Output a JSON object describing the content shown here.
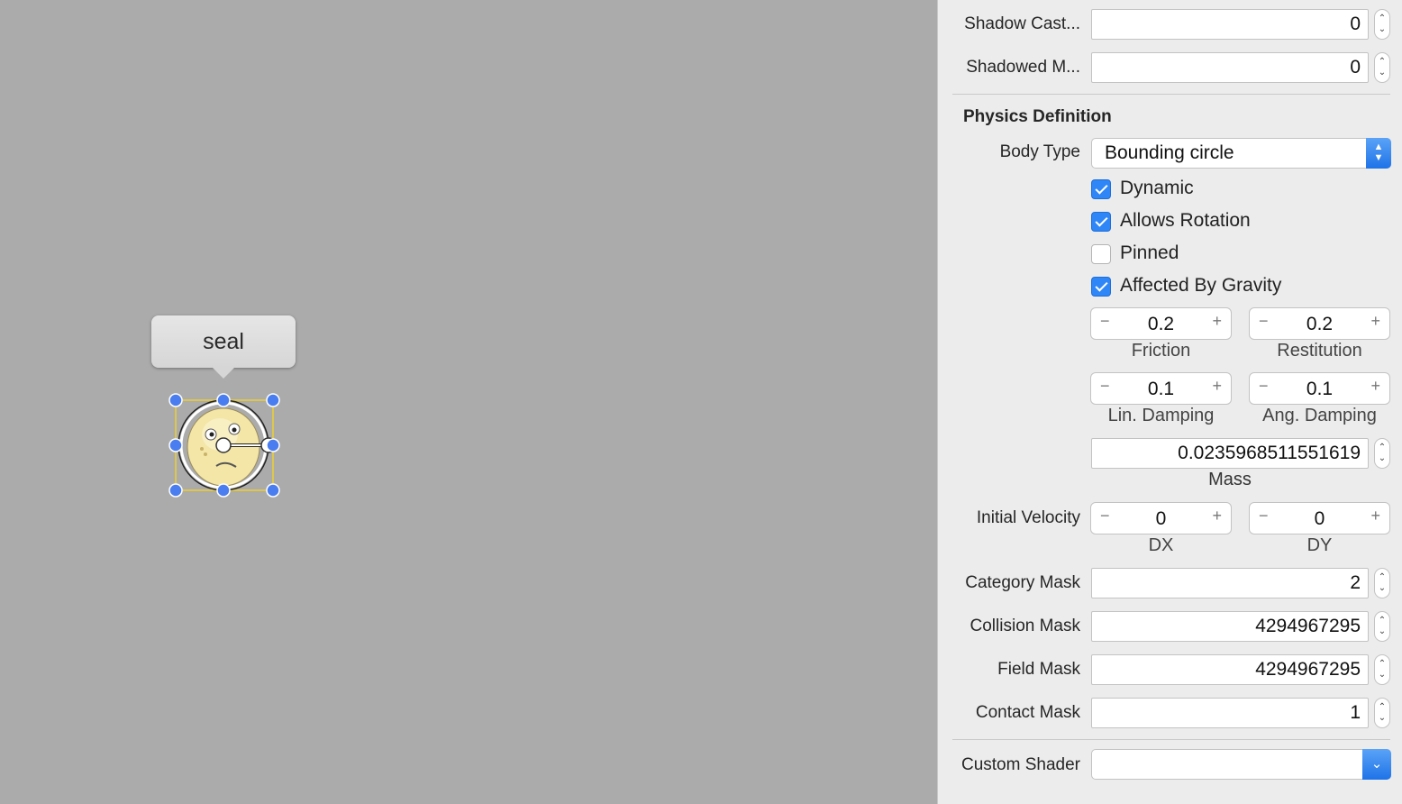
{
  "canvas": {
    "node_name": "seal"
  },
  "inspector": {
    "shadow_cast": {
      "label": "Shadow Cast...",
      "value": "0"
    },
    "shadowed_mask": {
      "label": "Shadowed M...",
      "value": "0"
    },
    "physics": {
      "heading": "Physics Definition",
      "body_type": {
        "label": "Body Type",
        "value": "Bounding circle"
      },
      "checkboxes": [
        {
          "label": "Dynamic",
          "checked": true
        },
        {
          "label": "Allows Rotation",
          "checked": true
        },
        {
          "label": "Pinned",
          "checked": false
        },
        {
          "label": "Affected By Gravity",
          "checked": true
        }
      ],
      "friction": {
        "label": "Friction",
        "value": "0.2"
      },
      "restitution": {
        "label": "Restitution",
        "value": "0.2"
      },
      "lin_damping": {
        "label": "Lin. Damping",
        "value": "0.1"
      },
      "ang_damping": {
        "label": "Ang. Damping",
        "value": "0.1"
      },
      "mass": {
        "label": "Mass",
        "value": "0.0235968511551619"
      },
      "initial_velocity": {
        "label": "Initial Velocity",
        "dx": {
          "label": "DX",
          "value": "0"
        },
        "dy": {
          "label": "DY",
          "value": "0"
        }
      },
      "category_mask": {
        "label": "Category Mask",
        "value": "2"
      },
      "collision_mask": {
        "label": "Collision Mask",
        "value": "4294967295"
      },
      "field_mask": {
        "label": "Field Mask",
        "value": "4294967295"
      },
      "contact_mask": {
        "label": "Contact Mask",
        "value": "1"
      }
    },
    "custom_shader": {
      "label": "Custom Shader",
      "value": ""
    },
    "glyphs": {
      "minus": "−",
      "plus": "+",
      "up": "⌃",
      "down": "⌄",
      "chevron": "⌄"
    }
  },
  "colors": {
    "canvas_bg": "#ababab",
    "inspector_bg": "#ececec",
    "accent": "#2f86f6",
    "selection_handle": "#4a7ef0",
    "selection_border": "#f0d030"
  }
}
